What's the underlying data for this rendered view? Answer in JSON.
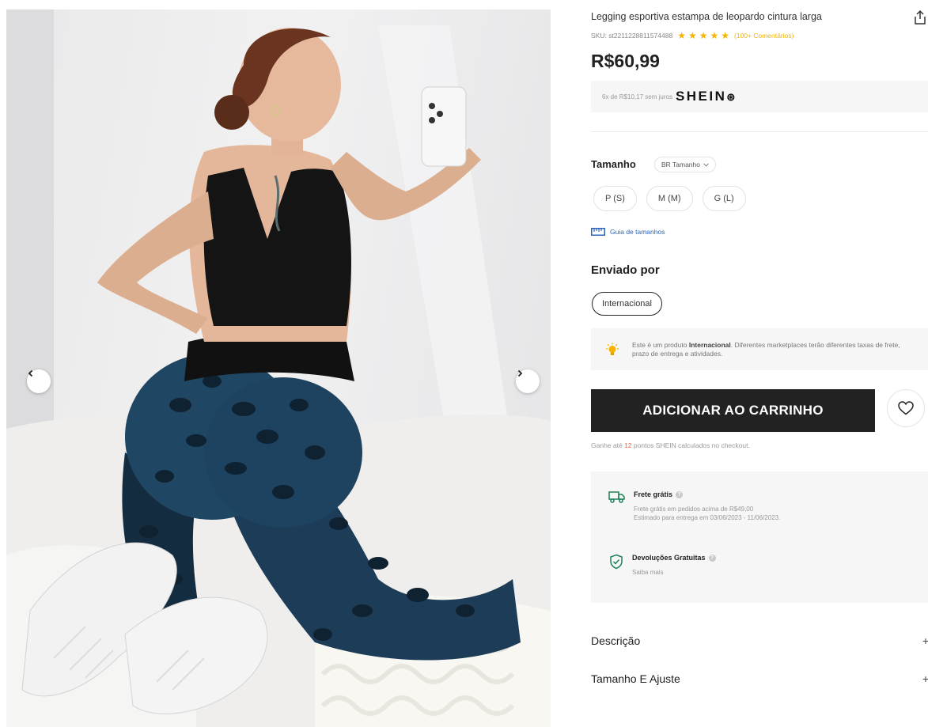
{
  "product": {
    "title": "Legging esportiva estampa de leopardo cintura larga",
    "sku": "SKU: st2211228811574488",
    "rating_stars": 5,
    "reviews": "(100+ Comentários)",
    "price": "R$60,99"
  },
  "installment": {
    "text": "6x de R$10,17 sem juros",
    "brand": "SHEIN"
  },
  "size": {
    "label": "Tamanho",
    "dropdown": "BR Tamanho",
    "options": [
      "P (S)",
      "M (M)",
      "G (L)"
    ],
    "guide": "Guia de tamanhos"
  },
  "shipping_from": {
    "label": "Enviado por",
    "option": "Internacional",
    "notice_prefix": "Este é um produto ",
    "notice_bold": "Internacional",
    "notice_suffix": ". Diferentes marketplaces terão diferentes taxas de frete, prazo de entrega e atividades."
  },
  "actions": {
    "add_to_cart": "ADICIONAR AO CARRINHO",
    "points_prefix": "Ganhe até ",
    "points_value": "12",
    "points_suffix": " pontos SHEIN calculados no checkout."
  },
  "benefits": {
    "free_shipping_title": "Frete grátis",
    "free_shipping_line1": "Frete grátis em pedidos acima de R$49,00",
    "free_shipping_line2": "Estimado para entrega em 03/06/2023 - 11/06/2023.",
    "returns_title": "Devoluções Gratuitas",
    "returns_link": "Saiba mais"
  },
  "accordions": {
    "description": "Descrição",
    "size_fit": "Tamanho E Ajuste"
  },
  "colors": {
    "accent_star": "#f4b400",
    "points_highlight": "#fa6338",
    "button_dark": "#222222",
    "benefit_green": "#1b8157",
    "link_blue": "#2f64b8"
  }
}
